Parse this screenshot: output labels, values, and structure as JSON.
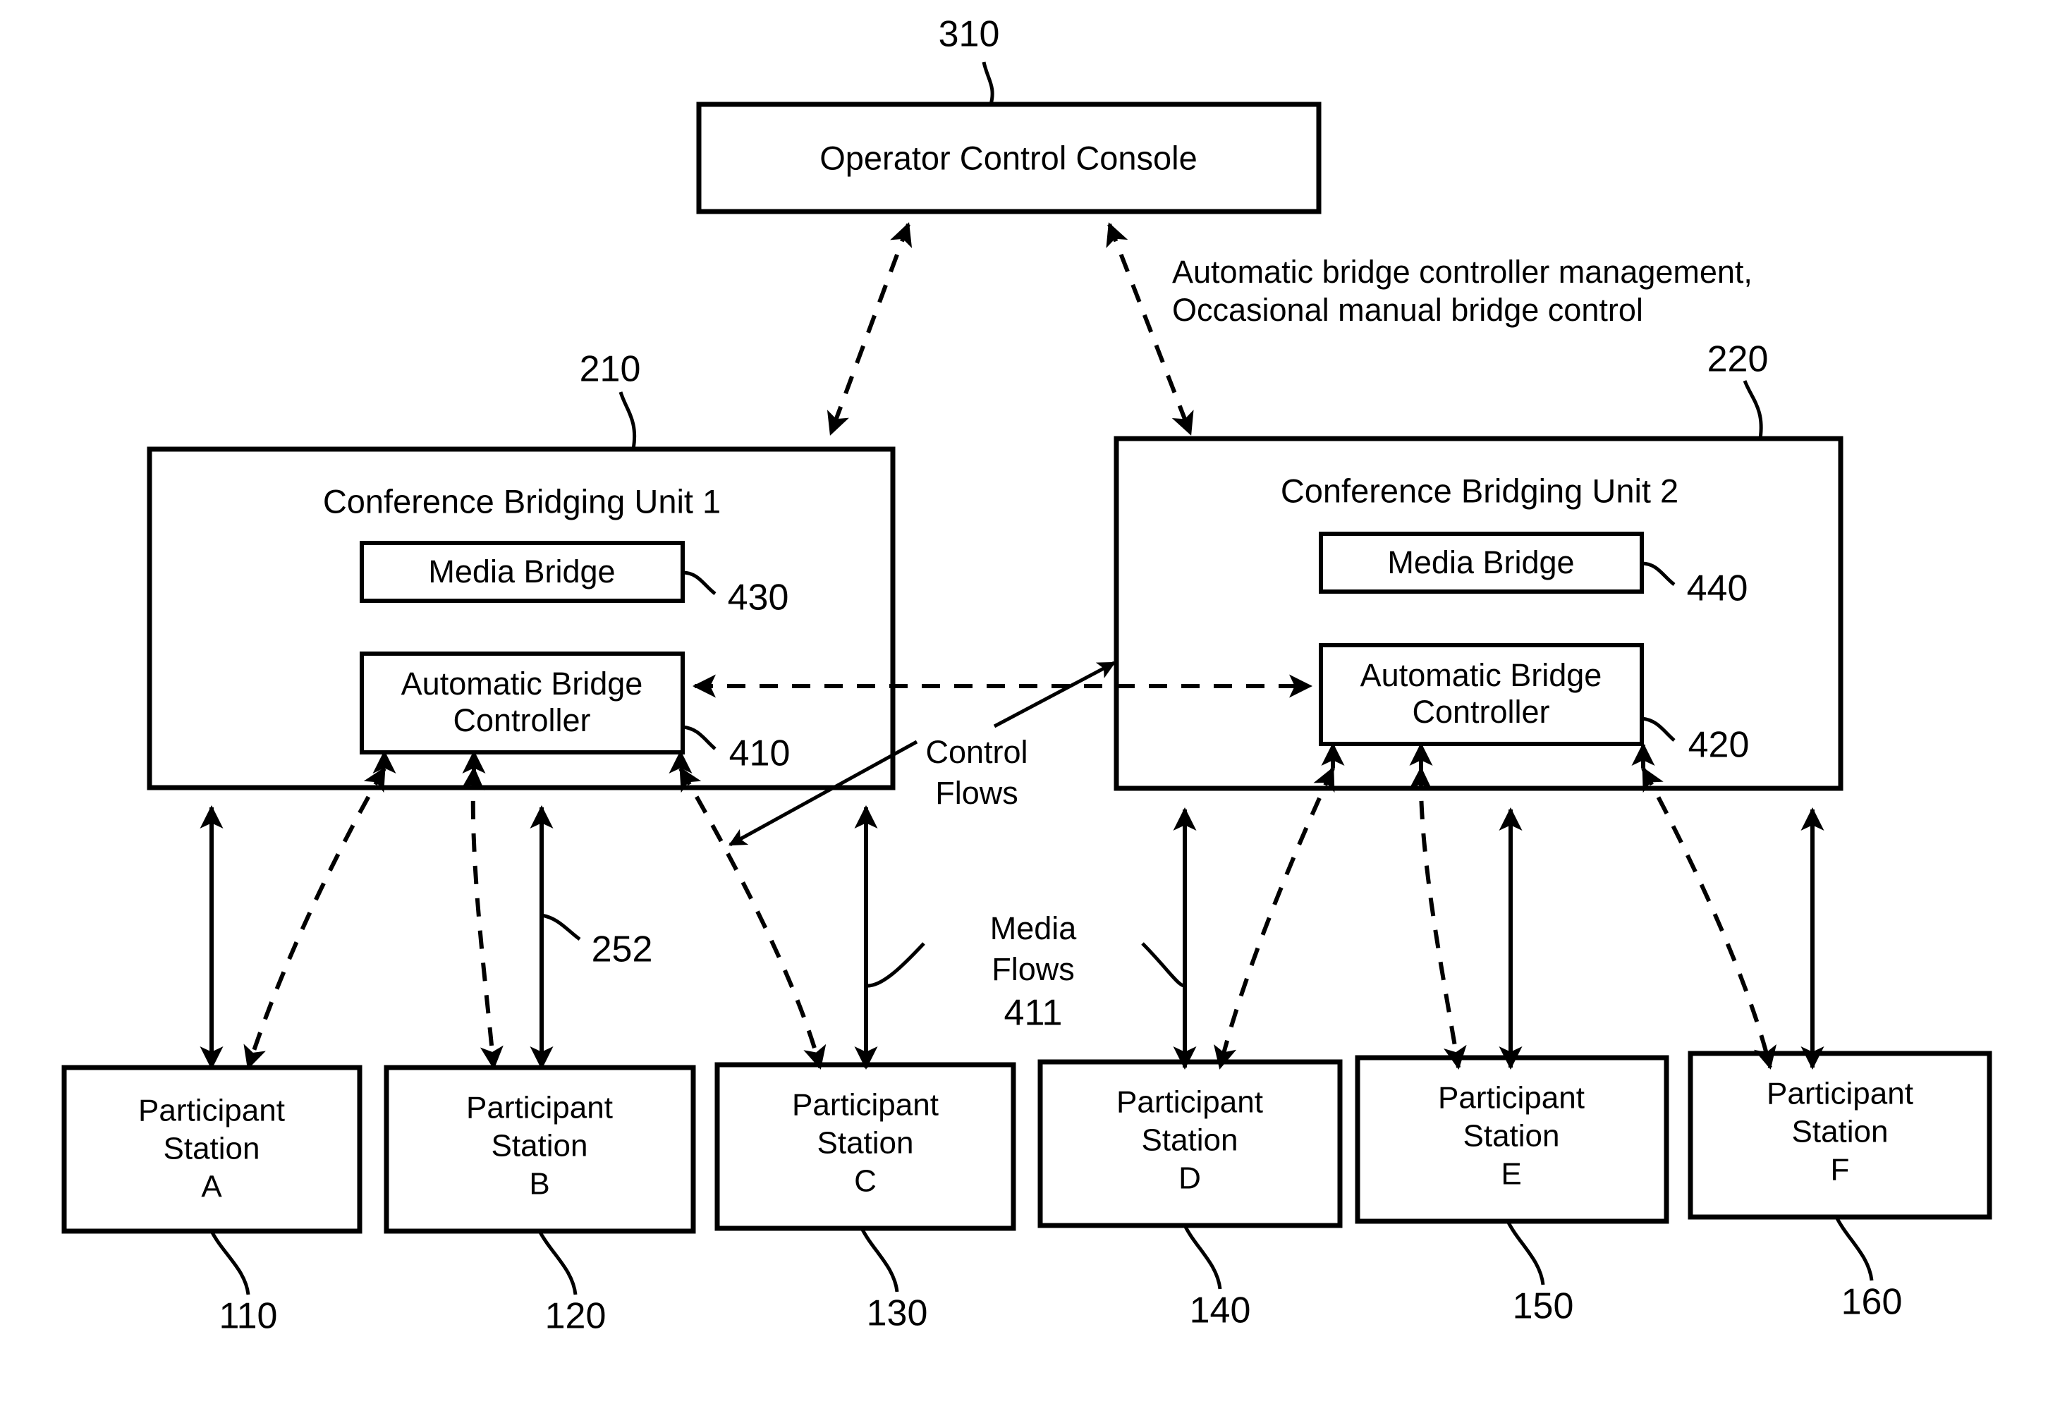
{
  "figure": {
    "operator_console": {
      "label": "Operator Control Console",
      "ref": "310"
    },
    "annotation": {
      "line1": "Automatic bridge controller management,",
      "line2": "Occasional manual bridge control"
    },
    "bridging_units": [
      {
        "title": "Conference Bridging Unit 1",
        "ref": "210",
        "media_bridge": {
          "label": "Media Bridge",
          "ref": "430"
        },
        "auto_controller": {
          "line1": "Automatic Bridge",
          "line2": "Controller",
          "ref": "410"
        }
      },
      {
        "title": "Conference Bridging Unit 2",
        "ref": "220",
        "media_bridge": {
          "label": "Media Bridge",
          "ref": "440"
        },
        "auto_controller": {
          "line1": "Automatic Bridge",
          "line2": "Controller",
          "ref": "420"
        }
      }
    ],
    "flow_labels": {
      "control_flows_line1": "Control",
      "control_flows_line2": "Flows",
      "media_flows_line1": "Media",
      "media_flows_line2": "Flows",
      "media_flows_ref": "411",
      "media_link_ref": "252"
    },
    "participant_stations": [
      {
        "line1": "Participant",
        "line2": "Station",
        "letter": "A",
        "ref": "110"
      },
      {
        "line1": "Participant",
        "line2": "Station",
        "letter": "B",
        "ref": "120"
      },
      {
        "line1": "Participant",
        "line2": "Station",
        "letter": "C",
        "ref": "130"
      },
      {
        "line1": "Participant",
        "line2": "Station",
        "letter": "D",
        "ref": "140"
      },
      {
        "line1": "Participant",
        "line2": "Station",
        "letter": "E",
        "ref": "150"
      },
      {
        "line1": "Participant",
        "line2": "Station",
        "letter": "F",
        "ref": "160"
      }
    ],
    "colors": {
      "stroke": "#000000",
      "background": "#ffffff"
    }
  }
}
